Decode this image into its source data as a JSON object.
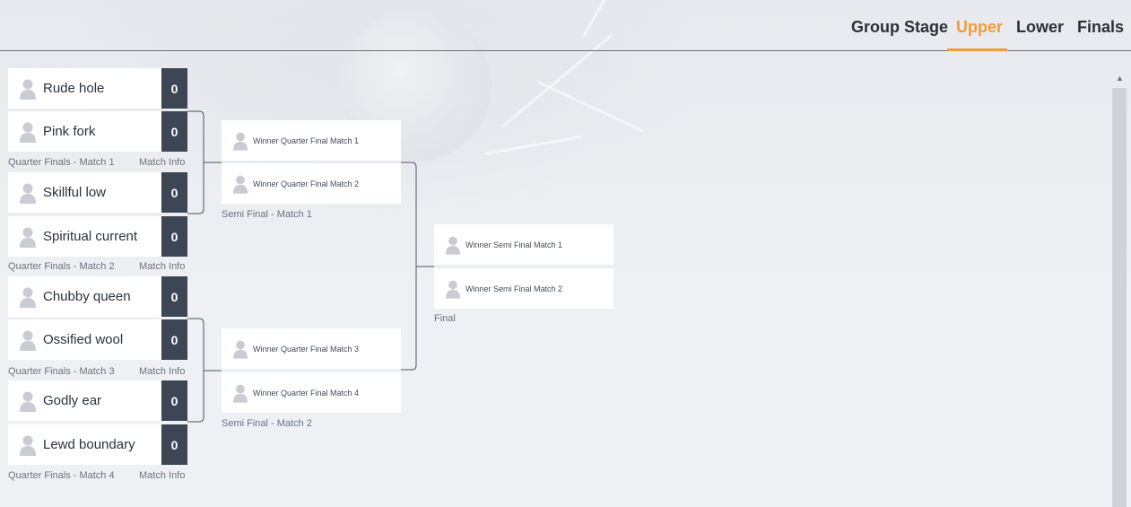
{
  "tabs": [
    {
      "label": "Group Stage",
      "active": false
    },
    {
      "label": "Upper",
      "active": true
    },
    {
      "label": "Lower",
      "active": false
    },
    {
      "label": "Finals",
      "active": false
    }
  ],
  "accent_color": "#f39a3a",
  "score_bg_color": "#3c4655",
  "quarter_finals": [
    {
      "label": "Quarter Finals - Match 1",
      "info": "Match Info",
      "players": [
        {
          "name": "Rude hole",
          "score": "0"
        },
        {
          "name": "Pink fork",
          "score": "0"
        }
      ]
    },
    {
      "label": "Quarter Finals - Match 2",
      "info": "Match Info",
      "players": [
        {
          "name": "Skillful low",
          "score": "0"
        },
        {
          "name": "Spiritual current",
          "score": "0"
        }
      ]
    },
    {
      "label": "Quarter Finals - Match 3",
      "info": "Match Info",
      "players": [
        {
          "name": "Chubby queen",
          "score": "0"
        },
        {
          "name": "Ossified wool",
          "score": "0"
        }
      ]
    },
    {
      "label": "Quarter Finals - Match 4",
      "info": "Match Info",
      "players": [
        {
          "name": "Godly ear",
          "score": "0"
        },
        {
          "name": "Lewd boundary",
          "score": "0"
        }
      ]
    }
  ],
  "semi_finals": [
    {
      "label": "Semi Final - Match 1",
      "players": [
        {
          "name": "Winner Quarter Final Match 1"
        },
        {
          "name": "Winner Quarter Final Match 2"
        }
      ]
    },
    {
      "label": "Semi Final - Match 2",
      "players": [
        {
          "name": "Winner Quarter Final Match 3"
        },
        {
          "name": "Winner Quarter Final Match 4"
        }
      ]
    }
  ],
  "final": {
    "label": "Final",
    "players": [
      {
        "name": "Winner Semi Final Match 1"
      },
      {
        "name": "Winner Semi Final Match 2"
      }
    ]
  },
  "icons": {
    "avatar": "user-avatar-icon",
    "scroll_up": "scroll-up-arrow-icon"
  }
}
